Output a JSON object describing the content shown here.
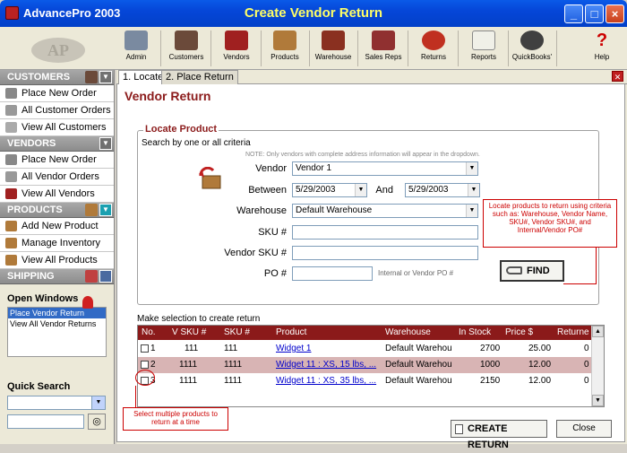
{
  "titlebar": {
    "app_name": "AdvancePro 2003",
    "window_title": "Create Vendor Return"
  },
  "toolbar": {
    "items": [
      {
        "label": "Admin",
        "icon": "admin-icon"
      },
      {
        "label": "Customers",
        "icon": "customers-icon"
      },
      {
        "label": "Vendors",
        "icon": "vendors-icon"
      },
      {
        "label": "Products",
        "icon": "products-icon"
      },
      {
        "label": "Warehouse",
        "icon": "warehouse-icon"
      },
      {
        "label": "Sales Reps",
        "icon": "sales-reps-icon"
      },
      {
        "label": "Returns",
        "icon": "returns-icon"
      },
      {
        "label": "Reports",
        "icon": "reports-icon"
      },
      {
        "label": "QuickBooks'",
        "icon": "quickbooks-icon"
      },
      {
        "label": "Help",
        "icon": "help-icon"
      }
    ]
  },
  "sidebar": {
    "customers": {
      "title": "CUSTOMERS",
      "items": [
        "Place New Order",
        "All Customer Orders",
        "View All Customers"
      ]
    },
    "vendors": {
      "title": "VENDORS",
      "items": [
        "Place New Order",
        "All Vendor Orders",
        "View All Vendors"
      ]
    },
    "products": {
      "title": "PRODUCTS",
      "items": [
        "Add New Product",
        "Manage Inventory",
        "View All Products"
      ]
    },
    "shipping": {
      "title": "SHIPPING"
    },
    "open_windows": {
      "title": "Open Windows",
      "items": [
        "Place Vendor Return",
        "View All Vendor Returns"
      ]
    },
    "quick_search": {
      "title": "Quick Search"
    }
  },
  "tabs": [
    "1. Locate",
    "2. Place Return"
  ],
  "page_title": "Vendor Return",
  "locate": {
    "group_title": "Locate Product",
    "subtitle": "Search by one or all criteria",
    "note": "NOTE: Only vendors with complete address information will appear in the dropdown.",
    "vendor_label": "Vendor",
    "vendor_value": "Vendor 1",
    "between_label": "Between",
    "date_from": "5/29/2003",
    "and_label": "And",
    "date_to": "5/29/2003",
    "warehouse_label": "Warehouse",
    "warehouse_value": "Default Warehouse",
    "sku_label": "SKU #",
    "vendor_sku_label": "Vendor SKU #",
    "po_label": "PO #",
    "po_hint": "Internal or Vendor PO #",
    "find_label": "FIND"
  },
  "callouts": {
    "find_tip": "Locate products to return using criteria such as: Warehouse, Vendor Name, SKU#, Vendor SKU#, and Internal/Vendor PO#",
    "select_tip": "Select multiple products to return at a time"
  },
  "grid": {
    "caption": "Make selection to create return",
    "columns": [
      "No.",
      "V SKU #",
      "SKU #",
      "Product",
      "Warehouse",
      "In Stock",
      "Price  $",
      "Returne"
    ],
    "rows": [
      {
        "no": "1",
        "vsku": "111",
        "sku": "111",
        "product": "Widget 1",
        "warehouse": "Default Warehou",
        "instock": "2700",
        "price": "25.00",
        "returned": "0"
      },
      {
        "no": "2",
        "vsku": "1111",
        "sku": "1111",
        "product": "Widget 11 : XS, 15 lbs, ...",
        "warehouse": "Default Warehou",
        "instock": "1000",
        "price": "12.00",
        "returned": "0"
      },
      {
        "no": "3",
        "vsku": "1111",
        "sku": "1111",
        "product": "Widget 11 : XS, 35 lbs, ...",
        "warehouse": "Default Warehou",
        "instock": "2150",
        "price": "12.00",
        "returned": "0"
      }
    ]
  },
  "buttons": {
    "create_return": "CREATE RETURN",
    "close": "Close"
  },
  "colors": {
    "accent": "#8b1a1a",
    "titlebar": "#0546d8",
    "title_text": "#ffff66"
  }
}
